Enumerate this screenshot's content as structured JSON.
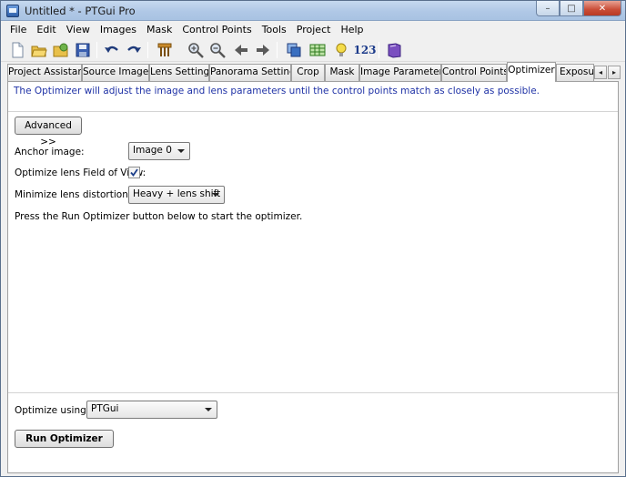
{
  "window": {
    "title": "Untitled * - PTGui Pro"
  },
  "caption_buttons": {
    "minimize": "–",
    "maximize": "□",
    "close": "✕"
  },
  "menu": [
    "File",
    "Edit",
    "View",
    "Images",
    "Mask",
    "Control Points",
    "Tools",
    "Project",
    "Help"
  ],
  "toolbar": {
    "icons": [
      "new-document-icon",
      "open-folder-icon",
      "open-recent-icon",
      "save-icon",
      "undo-icon",
      "redo-icon",
      "tripod-icon",
      "zoom-in-icon",
      "zoom-out-icon",
      "back-arrow-icon",
      "forward-arrow-icon",
      "panorama-editor-icon",
      "table-icon",
      "lightbulb-icon",
      "numbers-icon",
      "book-icon"
    ],
    "numbers_label": "123"
  },
  "tabs": {
    "items": [
      "Project Assistant",
      "Source Images",
      "Lens Settings",
      "Panorama Settings",
      "Crop",
      "Mask",
      "Image Parameters",
      "Control Points",
      "Optimizer",
      "Exposure"
    ],
    "active": "Optimizer",
    "scroll_left": "◂",
    "scroll_right": "▸"
  },
  "optimizer": {
    "info_text": "The Optimizer will adjust the image and lens parameters until the control points match as closely as possible.",
    "advanced_button": "Advanced >>",
    "anchor_label": "Anchor image:",
    "anchor_value": "Image 0",
    "fov_label": "Optimize lens Field of View:",
    "fov_checked": true,
    "distortion_label": "Minimize lens distortion:",
    "distortion_value": "Heavy + lens shift",
    "instruction_text": "Press the Run Optimizer button below to start the optimizer.",
    "optimize_using_label": "Optimize using:",
    "optimize_using_value": "PTGui",
    "run_button": "Run Optimizer"
  },
  "colors": {
    "info_text": "#1f32a6",
    "titlebar": "#b0c8e6",
    "close_button": "#c94c36"
  }
}
